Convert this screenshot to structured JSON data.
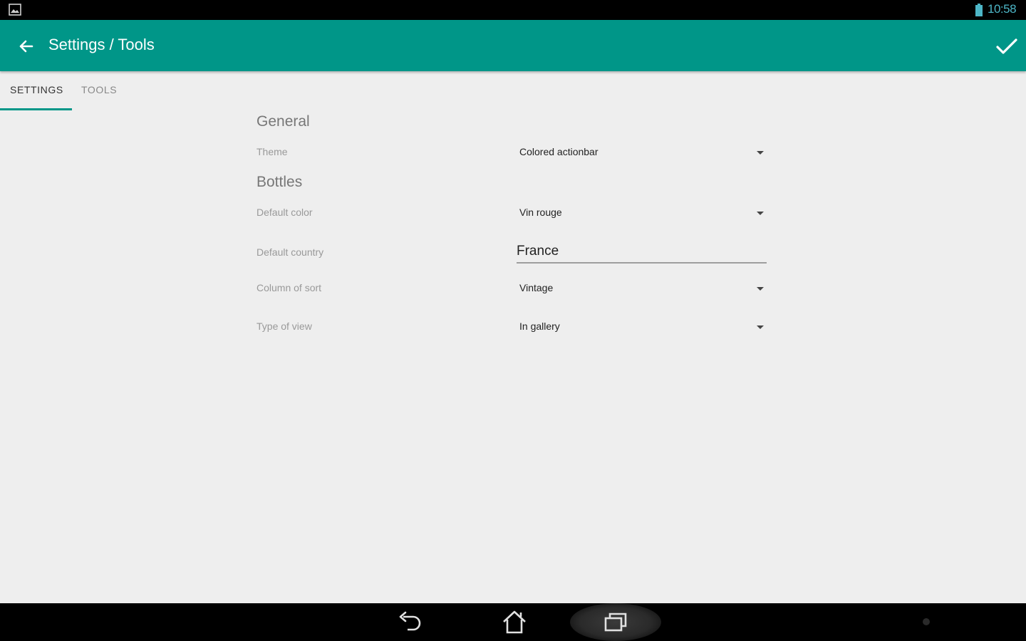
{
  "status_bar": {
    "time": "10:58",
    "icons": [
      "gallery-icon",
      "battery-icon"
    ]
  },
  "toolbar": {
    "title": "Settings / Tools",
    "back_icon": "arrow-back-icon",
    "confirm_icon": "checkmark-icon",
    "background": "#009688"
  },
  "tabs": [
    {
      "label": "SETTINGS",
      "active": true
    },
    {
      "label": "TOOLS",
      "active": false
    }
  ],
  "sections": {
    "general": {
      "title": "General",
      "theme": {
        "label": "Theme",
        "value": "Colored actionbar"
      }
    },
    "bottles": {
      "title": "Bottles",
      "default_color": {
        "label": "Default color",
        "value": "Vin rouge"
      },
      "default_country": {
        "label": "Default country",
        "value": "France"
      },
      "column_of_sort": {
        "label": "Column of sort",
        "value": "Vintage"
      },
      "type_of_view": {
        "label": "Type of view",
        "value": "In gallery"
      }
    }
  },
  "nav_bar": {
    "icons": [
      "back-nav-icon",
      "home-icon",
      "recent-apps-icon",
      "menu-dot-icon"
    ]
  }
}
